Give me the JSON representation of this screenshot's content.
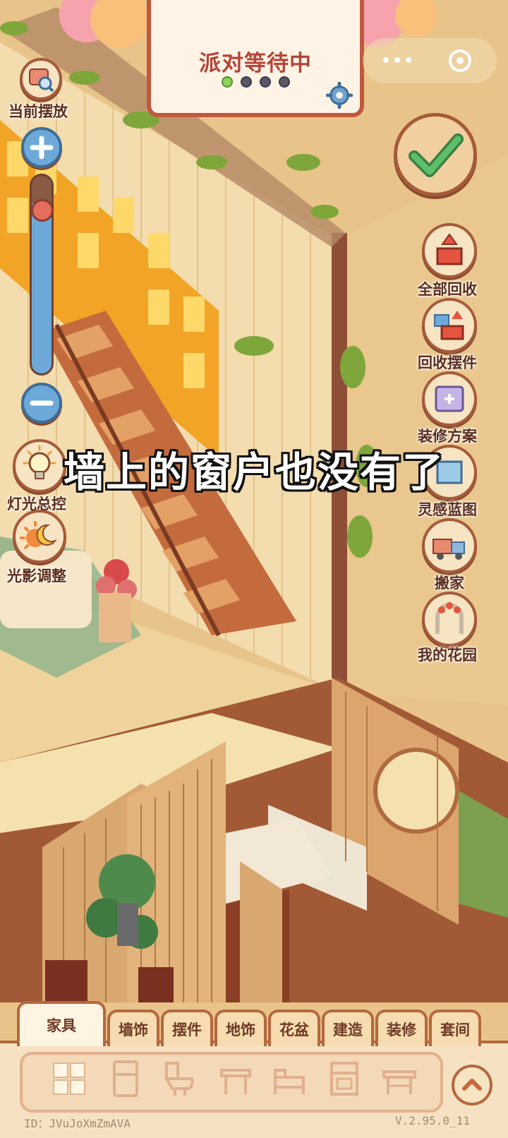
{
  "banner": {
    "title": "派对等待中",
    "progress_dots_total": 4,
    "progress_dots_active": 1
  },
  "left_tools": {
    "current_placement": "当前摆放",
    "light_control": "灯光总控",
    "light_shadow": "光影调整",
    "zoom_level": 0.86
  },
  "right_tools": [
    {
      "label": "全部回收",
      "icon": "recycle-all-icon"
    },
    {
      "label": "回收摆件",
      "icon": "recycle-ornament-icon"
    },
    {
      "label": "装修方案",
      "icon": "decoration-plan-icon"
    },
    {
      "label": "灵感蓝图",
      "icon": "inspiration-blueprint-icon"
    },
    {
      "label": "搬家",
      "icon": "moving-truck-icon"
    },
    {
      "label": "我的花园",
      "icon": "garden-arch-icon"
    }
  ],
  "subtitle": "墙上的窗户也没有了",
  "tabs": [
    "家具",
    "墙饰",
    "摆件",
    "地饰",
    "花盆",
    "建造",
    "装修",
    "套间"
  ],
  "active_tab": 0,
  "category_icons": [
    "grid-icon",
    "fridge-icon",
    "toilet-icon",
    "table-icon",
    "bed-icon",
    "cabinet-icon",
    "desk-icon"
  ],
  "footer": {
    "id": "ID：JVuJoXmZmAVA",
    "version": "V.2.95.0_11"
  },
  "colors": {
    "accent": "#b5683f",
    "title": "#b2463a",
    "confirm_check": "#4cae5c"
  }
}
